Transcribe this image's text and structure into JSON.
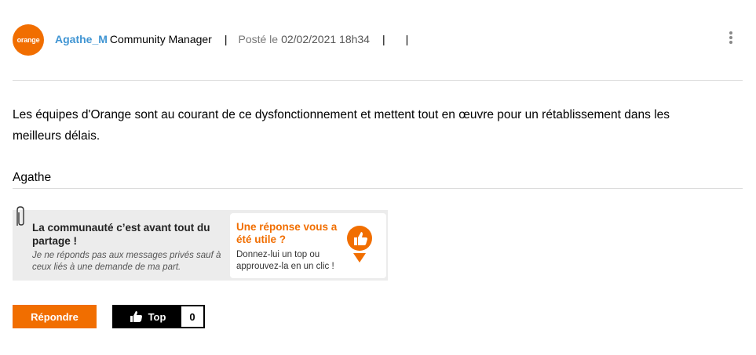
{
  "post": {
    "avatar_text": "orange",
    "author": "Agathe_M",
    "role": "Community Manager",
    "posted_label": "Posté le",
    "posted_date": "02/02/2021 18h34",
    "separator": "|",
    "body": "Les équipes d'Orange sont au courant de ce dysfonctionnement et mettent tout en œuvre pour un rétablissement dans les meilleurs délais.",
    "signature": "Agathe"
  },
  "banner": {
    "left_title": "La communauté c’est avant tout du partage !",
    "left_sub": "Je ne réponds pas aux messages privés sauf à ceux liés à une demande de ma part.",
    "right_title": "Une réponse vous a été utile ?",
    "right_sub": "Donnez-lui un top ou approuvez-la en un clic !"
  },
  "actions": {
    "reply_label": "Répondre",
    "top_label": "Top",
    "top_count": "0"
  },
  "icons": {
    "menu": "more-vertical-icon",
    "thumb": "thumbs-up-icon",
    "clip": "paperclip-icon"
  },
  "colors": {
    "brand": "#f16e00",
    "author_link": "#4095d3"
  }
}
